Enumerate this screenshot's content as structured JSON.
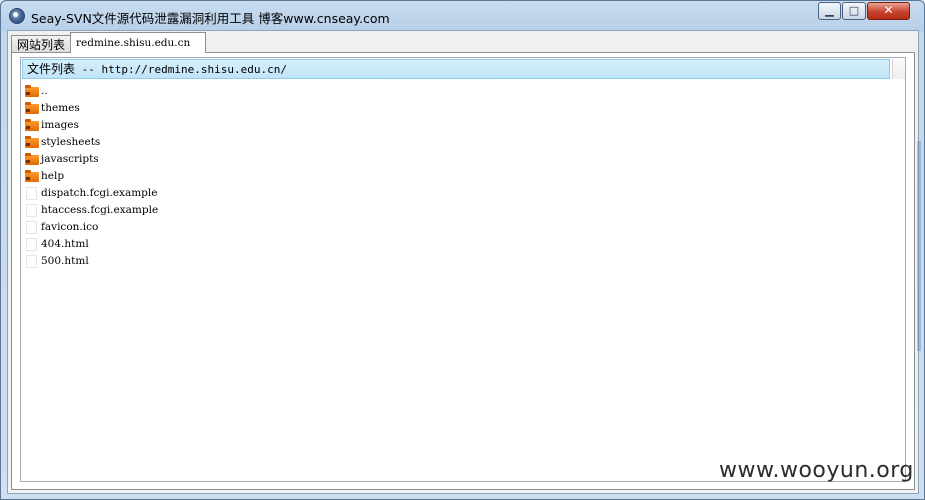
{
  "window": {
    "title": "Seay-SVN文件源代码泄露漏洞利用工具  博客www.cnseay.com",
    "min_glyph": "▁",
    "max_glyph": "□",
    "close_glyph": "✕"
  },
  "tabs": [
    {
      "label": "网站列表",
      "active": false
    },
    {
      "label": "redmine.shisu.edu.cn",
      "active": true
    }
  ],
  "file_list": {
    "header_prefix": "文件列表",
    "header_path": " -- http://redmine.shisu.edu.cn/",
    "items": [
      {
        "name": "..",
        "icon": "folder-icon"
      },
      {
        "name": "themes",
        "icon": "folder-icon"
      },
      {
        "name": "images",
        "icon": "folder-icon"
      },
      {
        "name": "stylesheets",
        "icon": "folder-icon"
      },
      {
        "name": "javascripts",
        "icon": "folder-icon"
      },
      {
        "name": "help",
        "icon": "folder-icon"
      },
      {
        "name": "dispatch.fcgi.example",
        "icon": "file-icon"
      },
      {
        "name": "htaccess.fcgi.example",
        "icon": "file-icon"
      },
      {
        "name": "favicon.ico",
        "icon": "file-icon"
      },
      {
        "name": "404.html",
        "icon": "file-icon"
      },
      {
        "name": "500.html",
        "icon": "file-icon"
      }
    ]
  },
  "watermark": "www.wooyun.org",
  "colors": {
    "folder": "#ff8a1e",
    "header_bg": "#c0e4f8",
    "close_button": "#c8432c"
  }
}
